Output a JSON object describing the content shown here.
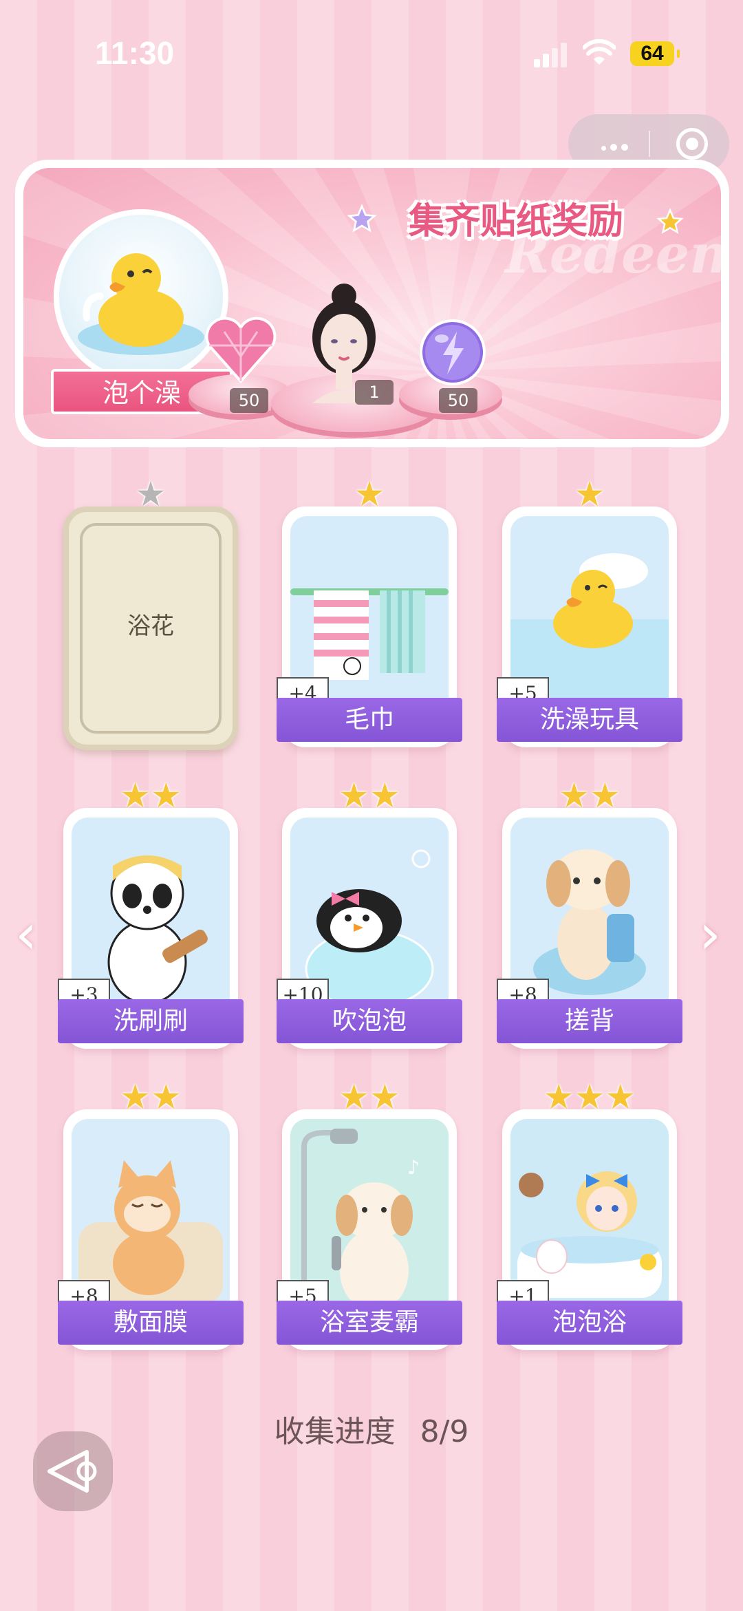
{
  "status_bar": {
    "time": "11:30",
    "battery": "64"
  },
  "banner": {
    "title": "集齐贴纸奖励",
    "watermark": "Redeem",
    "main_reward_label": "泡个澡",
    "rewards": [
      {
        "name": "heart-gem",
        "count": "50"
      },
      {
        "name": "character-portrait",
        "count": "1"
      },
      {
        "name": "purple-orb",
        "count": "50"
      }
    ]
  },
  "cards": [
    {
      "name": "浴花",
      "stars": 1,
      "locked": true
    },
    {
      "name": "毛巾",
      "stars": 1,
      "bonus": "+4"
    },
    {
      "name": "洗澡玩具",
      "stars": 1,
      "bonus": "+5"
    },
    {
      "name": "洗刷刷",
      "stars": 2,
      "bonus": "+3"
    },
    {
      "name": "吹泡泡",
      "stars": 2,
      "bonus": "+10"
    },
    {
      "name": "搓背",
      "stars": 2,
      "bonus": "+8"
    },
    {
      "name": "敷面膜",
      "stars": 2,
      "bonus": "+8"
    },
    {
      "name": "浴室麦霸",
      "stars": 2,
      "bonus": "+5"
    },
    {
      "name": "泡泡浴",
      "stars": 3,
      "bonus": "+1"
    }
  ],
  "progress": {
    "label": "收集进度",
    "value": "8/9"
  },
  "colors": {
    "accent_purple": "#8a5ad8",
    "accent_pink": "#e9557f",
    "star_gold": "#f7c434"
  }
}
